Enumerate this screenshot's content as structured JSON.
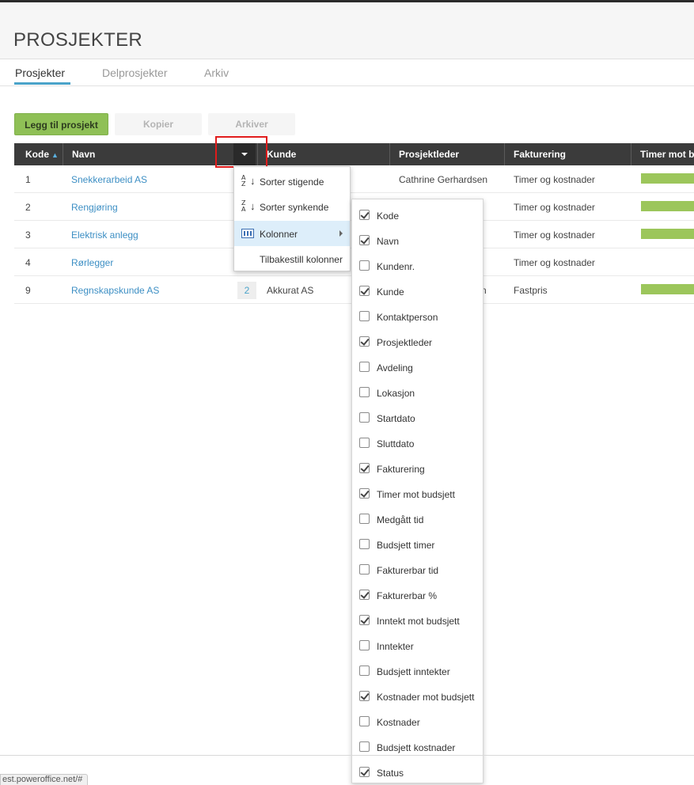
{
  "page": {
    "title": "PROSJEKTER"
  },
  "tabs": [
    {
      "label": "Prosjekter",
      "active": true
    },
    {
      "label": "Delprosjekter",
      "active": false
    },
    {
      "label": "Arkiv",
      "active": false
    }
  ],
  "toolbar": {
    "add_label": "Legg til prosjekt",
    "copy_label": "Kopier",
    "archive_label": "Arkiver"
  },
  "grid": {
    "columns": [
      "Kode",
      "Navn",
      "Kunde",
      "Prosjektleder",
      "Fakturering",
      "Timer mot b"
    ],
    "sort_indicator": "▲",
    "rows": [
      {
        "kode": "1",
        "navn": "Snekkerarbeid AS",
        "kunde": "",
        "badge": "",
        "prosjektleder": "Cathrine Gerhardsen",
        "fakturering": "Timer og kostnader",
        "bar": true
      },
      {
        "kode": "2",
        "navn": "Rengjøring",
        "kunde": "",
        "badge": "",
        "prosjektleder": "",
        "fakturering": "Timer og kostnader",
        "bar": true
      },
      {
        "kode": "3",
        "navn": "Elektrisk anlegg",
        "kunde": "",
        "badge": "",
        "prosjektleder": "",
        "fakturering": "Timer og kostnader",
        "bar": true
      },
      {
        "kode": "4",
        "navn": "Rørlegger",
        "kunde": "",
        "badge": "",
        "prosjektleder": "",
        "fakturering": "Timer og kostnader",
        "bar": false
      },
      {
        "kode": "9",
        "navn": "Regnskapskunde AS",
        "kunde": "Akkurat AS",
        "badge": "2",
        "prosjektleder": "n",
        "fakturering": "Fastpris",
        "bar": true
      }
    ]
  },
  "context_menu": {
    "items": [
      {
        "label": "Sorter stigende",
        "icon": "sort-ascending-icon",
        "icon_letters": "A\nZ"
      },
      {
        "label": "Sorter synkende",
        "icon": "sort-descending-icon",
        "icon_letters": "Z\nA"
      },
      {
        "label": "Kolonner",
        "icon": "columns-icon",
        "has_submenu": true,
        "highlighted": true
      },
      {
        "label": "Tilbakestill kolonner",
        "icon": ""
      }
    ]
  },
  "columns_menu": [
    {
      "label": "Kode",
      "checked": true
    },
    {
      "label": "Navn",
      "checked": true
    },
    {
      "label": "Kundenr.",
      "checked": false
    },
    {
      "label": "Kunde",
      "checked": true
    },
    {
      "label": "Kontaktperson",
      "checked": false
    },
    {
      "label": "Prosjektleder",
      "checked": true
    },
    {
      "label": "Avdeling",
      "checked": false
    },
    {
      "label": "Lokasjon",
      "checked": false
    },
    {
      "label": "Startdato",
      "checked": false
    },
    {
      "label": "Sluttdato",
      "checked": false
    },
    {
      "label": "Fakturering",
      "checked": true
    },
    {
      "label": "Timer mot budsjett",
      "checked": true
    },
    {
      "label": "Medgått tid",
      "checked": false
    },
    {
      "label": "Budsjett timer",
      "checked": false
    },
    {
      "label": "Fakturerbar tid",
      "checked": false
    },
    {
      "label": "Fakturerbar %",
      "checked": true
    },
    {
      "label": "Inntekt mot budsjett",
      "checked": true
    },
    {
      "label": "Inntekter",
      "checked": false
    },
    {
      "label": "Budsjett inntekter",
      "checked": false
    },
    {
      "label": "Kostnader mot budsjett",
      "checked": true
    },
    {
      "label": "Kostnader",
      "checked": false
    },
    {
      "label": "Budsjett kostnader",
      "checked": false
    },
    {
      "label": "Status",
      "checked": true
    }
  ],
  "status_bar": {
    "url": "est.poweroffice.net/#"
  },
  "colors": {
    "accent": "#4aa3c9",
    "primary_button": "#8fc056",
    "grid_header": "#3b3b3b",
    "progress_bar": "#9cc65b",
    "highlight": "#e01b1b"
  }
}
